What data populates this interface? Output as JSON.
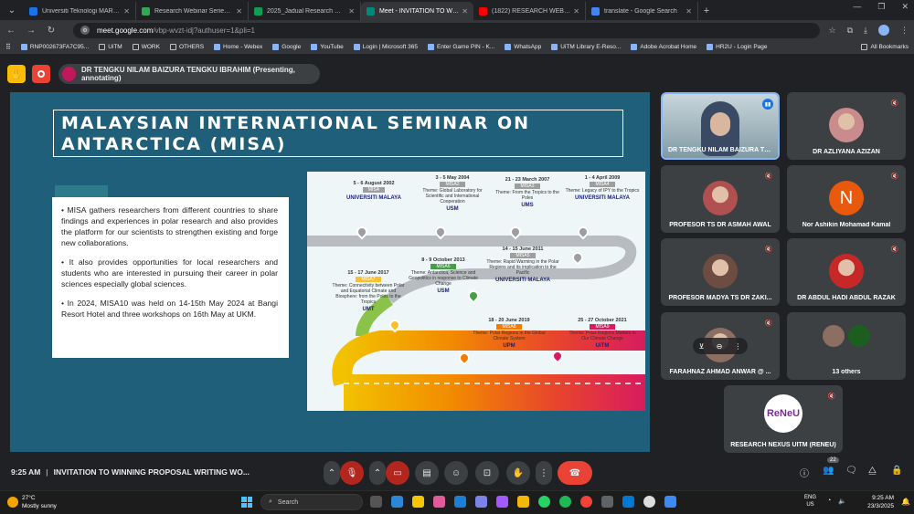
{
  "browser": {
    "tabs": [
      {
        "label": "Universiti Teknologi MARA - Ca...",
        "color": "#1a73e8"
      },
      {
        "label": "Research Webinar Series 7.0 20...",
        "color": "#34a853"
      },
      {
        "label": "2025_Jadual Research Webinar...",
        "color": "#0f9d58"
      },
      {
        "label": "Meet - INVITATION TO WIN...",
        "color": "#00897b",
        "active": true
      },
      {
        "label": "(1822) RESEARCH WEBINAR : FI...",
        "color": "#ff0000"
      },
      {
        "label": "translate - Google Search",
        "color": "#4285f4"
      }
    ],
    "new_tab": "+",
    "url_host": "meet.google.com",
    "url_path": "/vbp-wvzt-idj?authuser=1&pli=1",
    "bookmarks": [
      {
        "label": "RNP002673FA7C95...",
        "folder": false
      },
      {
        "label": "UiTM",
        "folder": true
      },
      {
        "label": "WORK",
        "folder": true
      },
      {
        "label": "OTHERS",
        "folder": true
      },
      {
        "label": "Home - Webex",
        "folder": false
      },
      {
        "label": "Google",
        "folder": false
      },
      {
        "label": "YouTube",
        "folder": false
      },
      {
        "label": "Login | Microsoft 365",
        "folder": false
      },
      {
        "label": "Enter Game PIN - K...",
        "folder": false
      },
      {
        "label": "WhatsApp",
        "folder": false
      },
      {
        "label": "UiTM Library E-Reso...",
        "folder": false
      },
      {
        "label": "Adobe Acrobat Home",
        "folder": false
      },
      {
        "label": "HR2U - Login Page",
        "folder": false
      }
    ],
    "all_bookmarks": "All Bookmarks"
  },
  "meet": {
    "presenter_label": "DR TENGKU NILAM BAIZURA TENGKU IBRAHIM (Presenting, annotating)",
    "slide": {
      "title": "MALAYSIAN INTERNATIONAL SEMINAR ON ANTARCTICA (MISA)",
      "paragraphs": [
        "MISA gathers researchers from different countries to share findings and experiences in polar research and also provides the platform for our scientists to strengthen existing and forge new collaborations.",
        "It also provides opportunities for local researchers and students who are interested in pursuing their career in polar sciences especially global sciences.",
        "In 2024, MISA10 was held on 14-15th May 2024 at Bangi Resort Hotel and three workshops on 16th May at UKM."
      ],
      "timeline": [
        {
          "date": "5 - 6 August 2002",
          "tag": "MISA",
          "theme": "",
          "host": "UNIVERSITI MALAYA"
        },
        {
          "date": "3 - 5 May 2004",
          "tag": "MISA2",
          "theme": "Theme: Global Laboratory for Scientific and International Cooperation",
          "host": "USM"
        },
        {
          "date": "21 - 23 March 2007",
          "tag": "MISA3",
          "theme": "Theme: From the Tropics to the Poles",
          "host": "UMS"
        },
        {
          "date": "1 - 4 April 2009",
          "tag": "MISA4",
          "theme": "Theme: Legacy of IPY to the Tropics",
          "host": "UNIVERSITI MALAYA"
        },
        {
          "date": "14 - 15 June 2011",
          "tag": "MISA5",
          "theme": "Theme: Rapid Warming in the Polar Regions and its implication to the Pacific",
          "host": "UNIVERSITI MALAYA"
        },
        {
          "date": "8 - 9 October 2013",
          "tag": "MISA6",
          "theme": "Theme: Antarctica, Science and Geopolitics in response to Climate Change",
          "host": "USM"
        },
        {
          "date": "15 - 17 June 2017",
          "tag": "MISA7",
          "theme": "Theme: Connectivity between Polar and Equatorial Climate and Biosphere: from the Poles to the Tropics",
          "host": "UMT"
        },
        {
          "date": "18 - 20 June 2019",
          "tag": "MISA8",
          "theme": "Theme: Polar Regions in the Global Climate System",
          "host": "UPM"
        },
        {
          "date": "25 - 27 October 2021",
          "tag": "MISA9",
          "theme": "Theme: Polar Regions Matters in Our Climate Change",
          "host": "UiTM"
        }
      ]
    },
    "participants": [
      {
        "name": "DR TENGKU NILAM BAIZURA TE...",
        "speaking": true
      },
      {
        "name": "DR AZLIYANA AZIZAN"
      },
      {
        "name": "PROFESOR TS DR ASMAH AWAL"
      },
      {
        "name": "Nor Ashikin Mohamad Kamal",
        "initial": "N"
      },
      {
        "name": "PROFESOR MADYA TS DR ZAKI..."
      },
      {
        "name": "DR ABDUL HADI ABDUL RAZAK"
      },
      {
        "name": "FARAHNAZ AHMAD ANWAR @ ..."
      },
      {
        "name": "13 others"
      },
      {
        "name": "RESEARCH NEXUS UITM (RENEU)",
        "logo_text": "ReNeU"
      }
    ],
    "time": "9:25 AM",
    "meeting_title": "INVITATION TO WINNING PROPOSAL WRITING WO...",
    "participant_count": "22"
  },
  "taskbar": {
    "temp": "27°C",
    "weather": "Mostly sunny",
    "search_placeholder": "Search",
    "lang": "ENG",
    "region": "US",
    "clock_time": "9:25 AM",
    "clock_date": "23/3/2025"
  }
}
